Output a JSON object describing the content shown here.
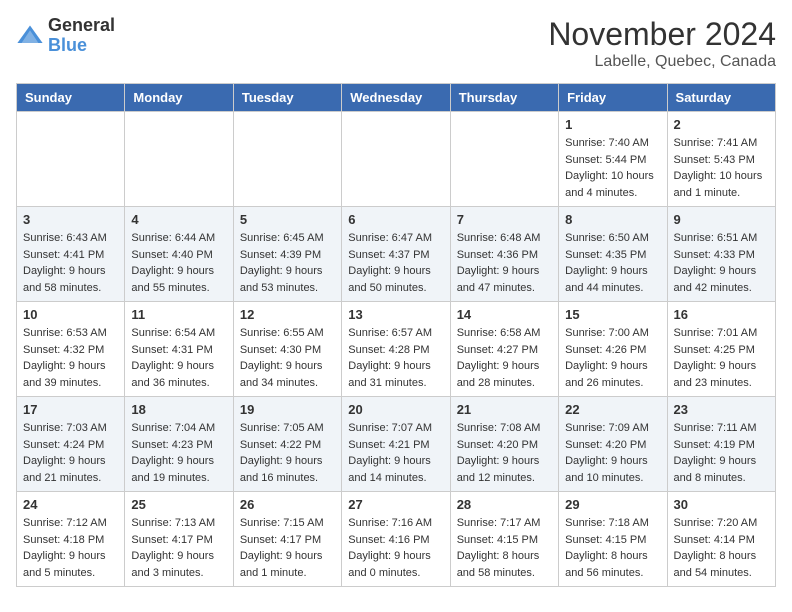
{
  "header": {
    "logo_general": "General",
    "logo_blue": "Blue",
    "month_year": "November 2024",
    "location": "Labelle, Quebec, Canada"
  },
  "days_of_week": [
    "Sunday",
    "Monday",
    "Tuesday",
    "Wednesday",
    "Thursday",
    "Friday",
    "Saturday"
  ],
  "weeks": [
    [
      {
        "day": "",
        "sunrise": "",
        "sunset": "",
        "daylight": ""
      },
      {
        "day": "",
        "sunrise": "",
        "sunset": "",
        "daylight": ""
      },
      {
        "day": "",
        "sunrise": "",
        "sunset": "",
        "daylight": ""
      },
      {
        "day": "",
        "sunrise": "",
        "sunset": "",
        "daylight": ""
      },
      {
        "day": "",
        "sunrise": "",
        "sunset": "",
        "daylight": ""
      },
      {
        "day": "1",
        "sunrise": "Sunrise: 7:40 AM",
        "sunset": "Sunset: 5:44 PM",
        "daylight": "Daylight: 10 hours and 4 minutes."
      },
      {
        "day": "2",
        "sunrise": "Sunrise: 7:41 AM",
        "sunset": "Sunset: 5:43 PM",
        "daylight": "Daylight: 10 hours and 1 minute."
      }
    ],
    [
      {
        "day": "3",
        "sunrise": "Sunrise: 6:43 AM",
        "sunset": "Sunset: 4:41 PM",
        "daylight": "Daylight: 9 hours and 58 minutes."
      },
      {
        "day": "4",
        "sunrise": "Sunrise: 6:44 AM",
        "sunset": "Sunset: 4:40 PM",
        "daylight": "Daylight: 9 hours and 55 minutes."
      },
      {
        "day": "5",
        "sunrise": "Sunrise: 6:45 AM",
        "sunset": "Sunset: 4:39 PM",
        "daylight": "Daylight: 9 hours and 53 minutes."
      },
      {
        "day": "6",
        "sunrise": "Sunrise: 6:47 AM",
        "sunset": "Sunset: 4:37 PM",
        "daylight": "Daylight: 9 hours and 50 minutes."
      },
      {
        "day": "7",
        "sunrise": "Sunrise: 6:48 AM",
        "sunset": "Sunset: 4:36 PM",
        "daylight": "Daylight: 9 hours and 47 minutes."
      },
      {
        "day": "8",
        "sunrise": "Sunrise: 6:50 AM",
        "sunset": "Sunset: 4:35 PM",
        "daylight": "Daylight: 9 hours and 44 minutes."
      },
      {
        "day": "9",
        "sunrise": "Sunrise: 6:51 AM",
        "sunset": "Sunset: 4:33 PM",
        "daylight": "Daylight: 9 hours and 42 minutes."
      }
    ],
    [
      {
        "day": "10",
        "sunrise": "Sunrise: 6:53 AM",
        "sunset": "Sunset: 4:32 PM",
        "daylight": "Daylight: 9 hours and 39 minutes."
      },
      {
        "day": "11",
        "sunrise": "Sunrise: 6:54 AM",
        "sunset": "Sunset: 4:31 PM",
        "daylight": "Daylight: 9 hours and 36 minutes."
      },
      {
        "day": "12",
        "sunrise": "Sunrise: 6:55 AM",
        "sunset": "Sunset: 4:30 PM",
        "daylight": "Daylight: 9 hours and 34 minutes."
      },
      {
        "day": "13",
        "sunrise": "Sunrise: 6:57 AM",
        "sunset": "Sunset: 4:28 PM",
        "daylight": "Daylight: 9 hours and 31 minutes."
      },
      {
        "day": "14",
        "sunrise": "Sunrise: 6:58 AM",
        "sunset": "Sunset: 4:27 PM",
        "daylight": "Daylight: 9 hours and 28 minutes."
      },
      {
        "day": "15",
        "sunrise": "Sunrise: 7:00 AM",
        "sunset": "Sunset: 4:26 PM",
        "daylight": "Daylight: 9 hours and 26 minutes."
      },
      {
        "day": "16",
        "sunrise": "Sunrise: 7:01 AM",
        "sunset": "Sunset: 4:25 PM",
        "daylight": "Daylight: 9 hours and 23 minutes."
      }
    ],
    [
      {
        "day": "17",
        "sunrise": "Sunrise: 7:03 AM",
        "sunset": "Sunset: 4:24 PM",
        "daylight": "Daylight: 9 hours and 21 minutes."
      },
      {
        "day": "18",
        "sunrise": "Sunrise: 7:04 AM",
        "sunset": "Sunset: 4:23 PM",
        "daylight": "Daylight: 9 hours and 19 minutes."
      },
      {
        "day": "19",
        "sunrise": "Sunrise: 7:05 AM",
        "sunset": "Sunset: 4:22 PM",
        "daylight": "Daylight: 9 hours and 16 minutes."
      },
      {
        "day": "20",
        "sunrise": "Sunrise: 7:07 AM",
        "sunset": "Sunset: 4:21 PM",
        "daylight": "Daylight: 9 hours and 14 minutes."
      },
      {
        "day": "21",
        "sunrise": "Sunrise: 7:08 AM",
        "sunset": "Sunset: 4:20 PM",
        "daylight": "Daylight: 9 hours and 12 minutes."
      },
      {
        "day": "22",
        "sunrise": "Sunrise: 7:09 AM",
        "sunset": "Sunset: 4:20 PM",
        "daylight": "Daylight: 9 hours and 10 minutes."
      },
      {
        "day": "23",
        "sunrise": "Sunrise: 7:11 AM",
        "sunset": "Sunset: 4:19 PM",
        "daylight": "Daylight: 9 hours and 8 minutes."
      }
    ],
    [
      {
        "day": "24",
        "sunrise": "Sunrise: 7:12 AM",
        "sunset": "Sunset: 4:18 PM",
        "daylight": "Daylight: 9 hours and 5 minutes."
      },
      {
        "day": "25",
        "sunrise": "Sunrise: 7:13 AM",
        "sunset": "Sunset: 4:17 PM",
        "daylight": "Daylight: 9 hours and 3 minutes."
      },
      {
        "day": "26",
        "sunrise": "Sunrise: 7:15 AM",
        "sunset": "Sunset: 4:17 PM",
        "daylight": "Daylight: 9 hours and 1 minute."
      },
      {
        "day": "27",
        "sunrise": "Sunrise: 7:16 AM",
        "sunset": "Sunset: 4:16 PM",
        "daylight": "Daylight: 9 hours and 0 minutes."
      },
      {
        "day": "28",
        "sunrise": "Sunrise: 7:17 AM",
        "sunset": "Sunset: 4:15 PM",
        "daylight": "Daylight: 8 hours and 58 minutes."
      },
      {
        "day": "29",
        "sunrise": "Sunrise: 7:18 AM",
        "sunset": "Sunset: 4:15 PM",
        "daylight": "Daylight: 8 hours and 56 minutes."
      },
      {
        "day": "30",
        "sunrise": "Sunrise: 7:20 AM",
        "sunset": "Sunset: 4:14 PM",
        "daylight": "Daylight: 8 hours and 54 minutes."
      }
    ]
  ]
}
